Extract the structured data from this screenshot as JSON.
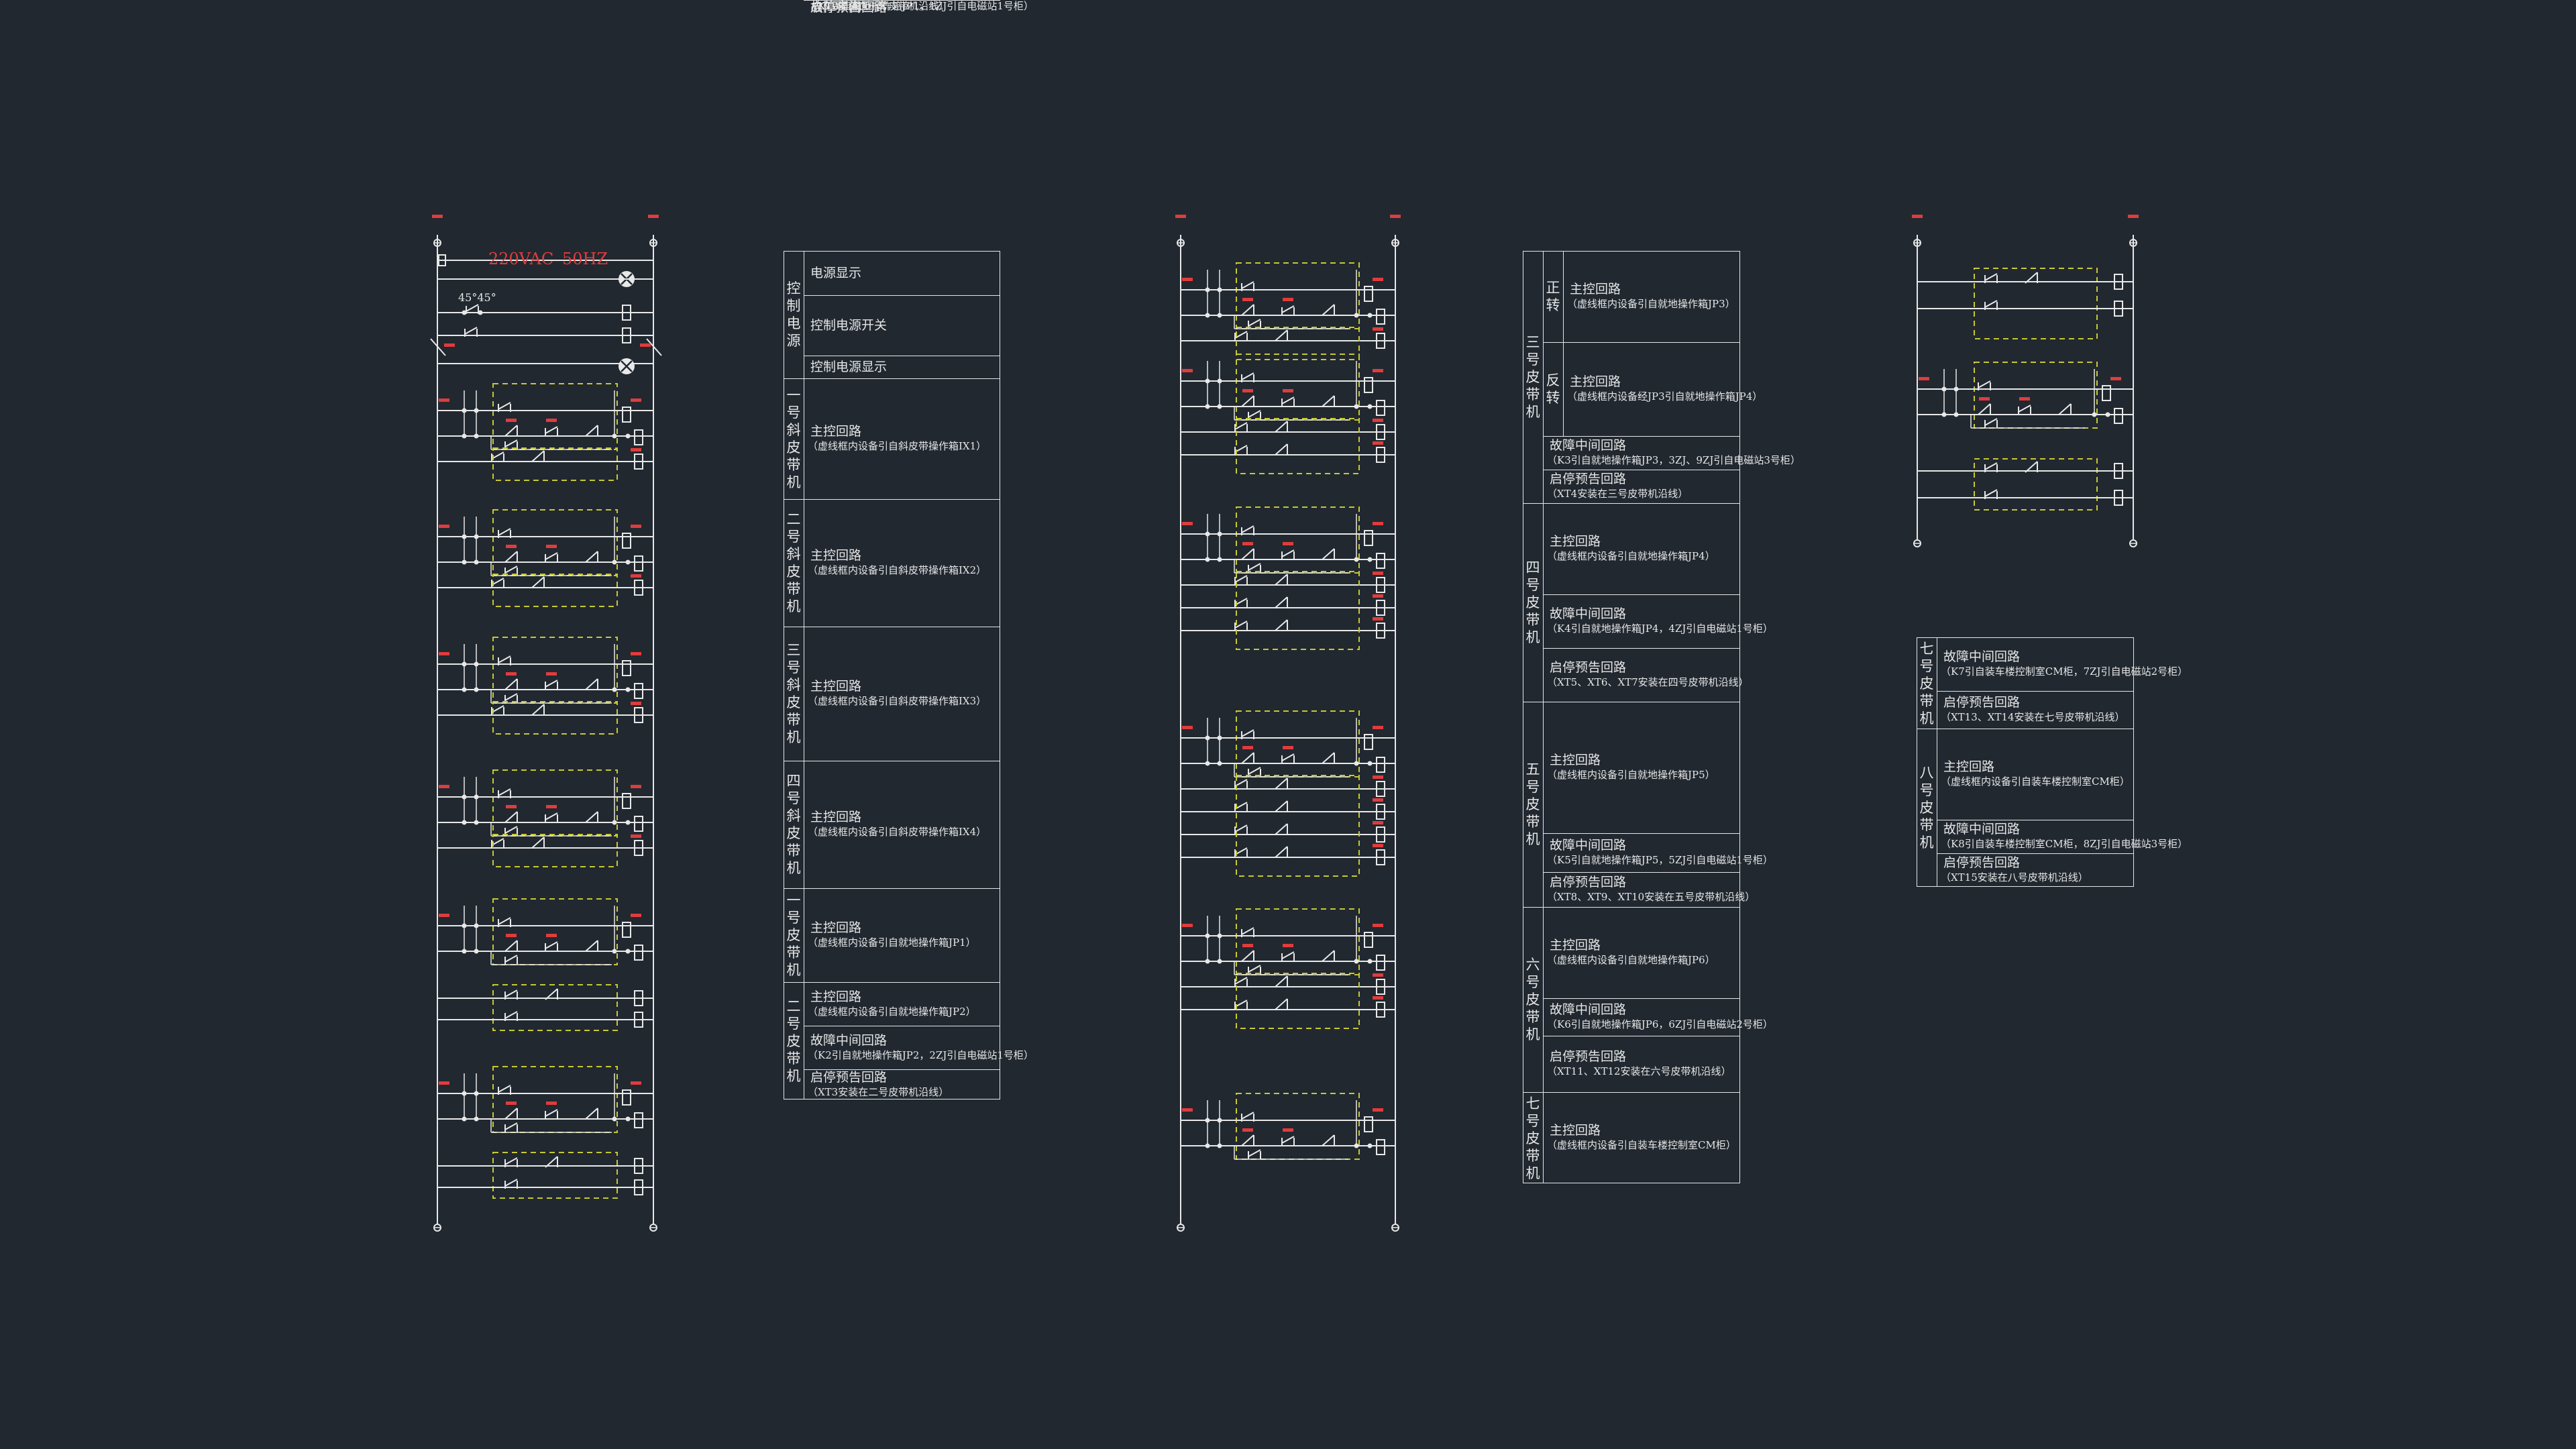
{
  "power_header": {
    "voltage": "220VAC",
    "frequency": "50HZ"
  },
  "contact_angle": "45°45°",
  "colors": {
    "background": "#212830",
    "wire": "#e8e8e8",
    "accent_red": "#e03c3c",
    "dashed_box": "#c8c832"
  },
  "legend_left": {
    "groups": [
      {
        "title": "控制电源",
        "rows": [
          {
            "title": "电源显示",
            "note": ""
          },
          {
            "title": "控制电源开关",
            "note": ""
          },
          {
            "title": "控制电源显示",
            "note": ""
          }
        ]
      },
      {
        "title": "一号斜皮带机",
        "rows": [
          {
            "title": "主控回路",
            "note": "（虚线框内设备引自斜皮带操作箱IX1）"
          }
        ]
      },
      {
        "title": "二号斜皮带机",
        "rows": [
          {
            "title": "主控回路",
            "note": "（虚线框内设备引自斜皮带操作箱IX2）"
          }
        ]
      },
      {
        "title": "三号斜皮带机",
        "rows": [
          {
            "title": "主控回路",
            "note": "（虚线框内设备引自斜皮带操作箱IX3）"
          }
        ]
      },
      {
        "title": "四号斜皮带机",
        "rows": [
          {
            "title": "主控回路",
            "note": "（虚线框内设备引自斜皮带操作箱IX4）"
          }
        ]
      },
      {
        "title": "一号皮带机",
        "rows": [
          {
            "title": "主控回路",
            "note": "（虚线框内设备引自就地操作箱JP1）"
          },
          {
            "title": "故障中间回路",
            "note": "（K1引自就地操作箱JP1，1ZJ引自电磁站1号柜）"
          },
          {
            "title": "启停预告回路",
            "note": "（XT2安装在一号皮带机沿线）"
          }
        ]
      },
      {
        "title": "二号皮带机",
        "rows": [
          {
            "title": "主控回路",
            "note": "（虚线框内设备引自就地操作箱JP2）"
          },
          {
            "title": "故障中间回路",
            "note": "（K2引自就地操作箱JP2，2ZJ引自电磁站1号柜）"
          },
          {
            "title": "启停预告回路",
            "note": "（XT3安装在二号皮带机沿线）"
          }
        ]
      }
    ]
  },
  "legend_middle": {
    "groups": [
      {
        "title": "三号皮带机",
        "rows": [
          {
            "sub": "正转",
            "title": "主控回路",
            "note": "（虚线框内设备引自就地操作箱JP3）"
          },
          {
            "sub": "反转",
            "title": "主控回路",
            "note": "（虚线框内设备经JP3引自就地操作箱JP4）"
          },
          {
            "sub": "",
            "title": "故障中间回路",
            "note": "（K3引自就地操作箱JP3，3ZJ、9ZJ引自电磁站3号柜）"
          },
          {
            "sub": "",
            "title": "启停预告回路",
            "note": "（XT4安装在三号皮带机沿线）"
          }
        ]
      },
      {
        "title": "四号皮带机",
        "rows": [
          {
            "title": "主控回路",
            "note": "（虚线框内设备引自就地操作箱JP4）"
          },
          {
            "title": "故障中间回路",
            "note": "（K4引自就地操作箱JP4，4ZJ引自电磁站1号柜）"
          },
          {
            "title": "启停预告回路",
            "note": "（XT5、XT6、XT7安装在四号皮带机沿线）"
          }
        ]
      },
      {
        "title": "五号皮带机",
        "rows": [
          {
            "title": "主控回路",
            "note": "（虚线框内设备引自就地操作箱JP5）"
          },
          {
            "title": "故障中间回路",
            "note": "（K5引自就地操作箱JP5，5ZJ引自电磁站1号柜）"
          },
          {
            "title": "启停预告回路",
            "note": "（XT8、XT9、XT10安装在五号皮带机沿线）"
          }
        ]
      },
      {
        "title": "六号皮带机",
        "rows": [
          {
            "title": "主控回路",
            "note": "（虚线框内设备引自就地操作箱JP6）"
          },
          {
            "title": "故障中间回路",
            "note": "（K6引自就地操作箱JP6，6ZJ引自电磁站2号柜）"
          },
          {
            "title": "启停预告回路",
            "note": "（XT11、XT12安装在六号皮带机沿线）"
          }
        ]
      },
      {
        "title": "七号皮带机",
        "rows": [
          {
            "title": "主控回路",
            "note": "（虚线框内设备引自装车楼控制室CM柜）"
          }
        ]
      }
    ]
  },
  "legend_right": {
    "groups": [
      {
        "title": "七号皮带机",
        "rows": [
          {
            "title": "故障中间回路",
            "note": "（K7引自装车楼控制室CM柜，7ZJ引自电磁站2号柜）"
          },
          {
            "title": "启停预告回路",
            "note": "（XT13、XT14安装在七号皮带机沿线）"
          }
        ]
      },
      {
        "title": "八号皮带机",
        "rows": [
          {
            "title": "主控回路",
            "note": "（虚线框内设备引自装车楼控制室CM柜）"
          },
          {
            "title": "故障中间回路",
            "note": "（K8引自装车楼控制室CM柜，8ZJ引自电磁站3号柜）"
          },
          {
            "title": "启停预告回路",
            "note": "（XT15安装在八号皮带机沿线）"
          }
        ]
      }
    ]
  }
}
